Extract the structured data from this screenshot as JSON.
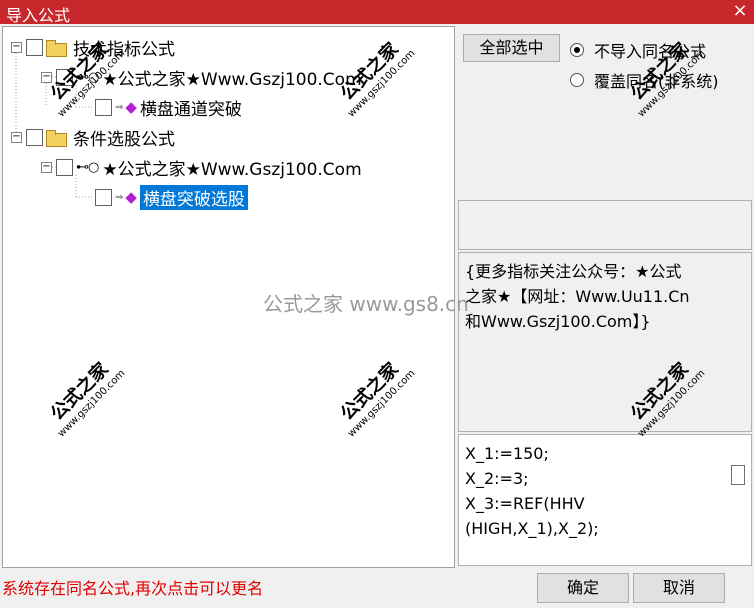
{
  "window": {
    "title": "导入公式",
    "close_label": "×"
  },
  "tree": {
    "group1": {
      "label": "技术指标公式",
      "expander": "−"
    },
    "group1_child": {
      "label": "★公式之家★Www.Gszj100.Com",
      "expander": "−"
    },
    "group1_leaf": {
      "label": "横盘通道突破"
    },
    "group2": {
      "label": "条件选股公式",
      "expander": "−"
    },
    "group2_child": {
      "label": "★公式之家★Www.Gszj100.Com",
      "expander": "−"
    },
    "group2_leaf": {
      "label": "横盘突破选股"
    }
  },
  "options": {
    "select_all_label": "全部选中",
    "radio_no_import": "不导入同名公式",
    "radio_overwrite": "覆盖同名(非系统)"
  },
  "description": {
    "line1": "{更多指标关注公众号：★公式",
    "line2": "之家★【网址：Www.Uu11.Cn",
    "line3": "和Www.Gszj100.Com】}"
  },
  "code": {
    "line1": "X_1:=150;",
    "line2": "X_2:=3;",
    "line3": "X_3:=REF(HHV",
    "line4": "(HIGH,X_1),X_2);"
  },
  "status": {
    "message": "系统存在同名公式,再次点击可以更名"
  },
  "buttons": {
    "ok_label": "确定",
    "cancel_label": "取消"
  },
  "watermark": {
    "brand": "公式之家",
    "url": "www.gszj100.com",
    "center_text": "公式之家 www.gs8.cn"
  },
  "colors": {
    "titlebar": "#c8282c",
    "selection": "#0078d7",
    "status_text": "#e00000",
    "gem": "#b020d0"
  }
}
